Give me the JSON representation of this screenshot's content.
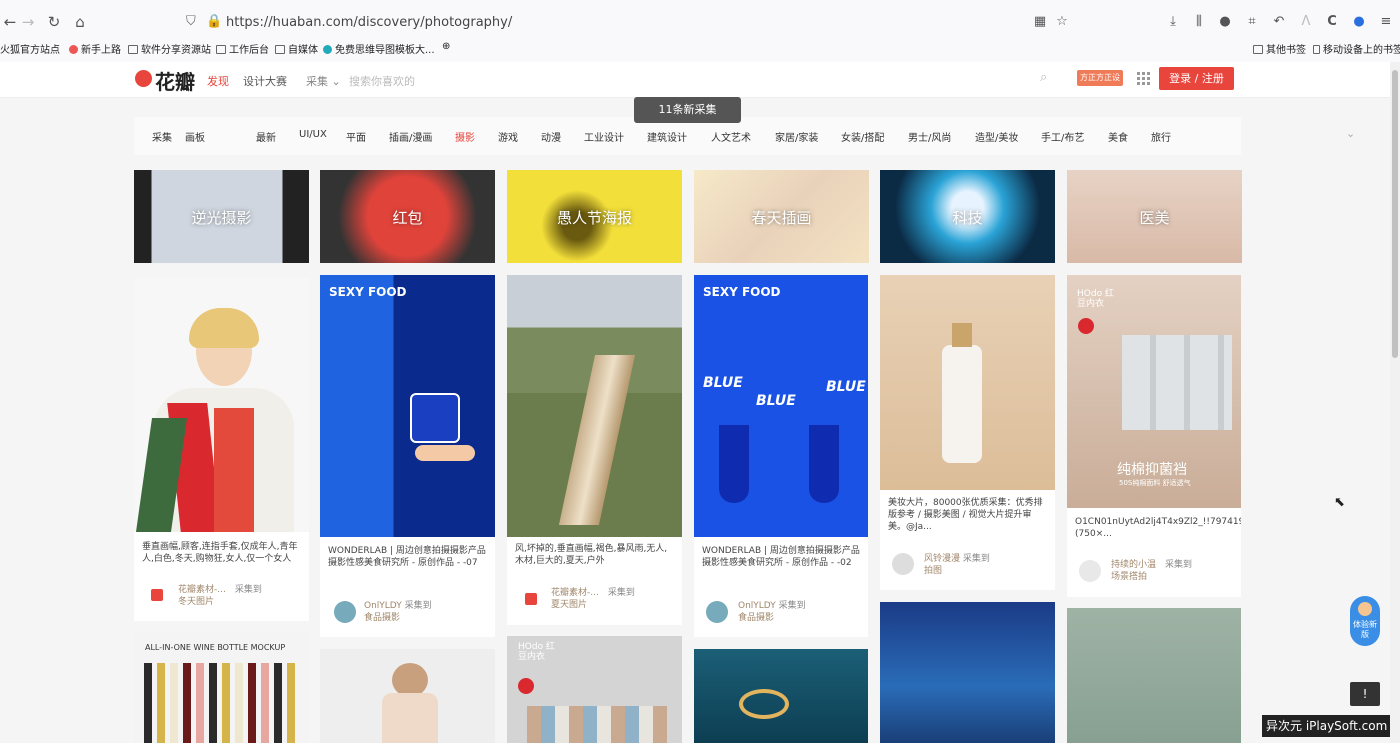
{
  "browser": {
    "url": "https://huaban.com/discovery/photography/",
    "bookmarks": [
      "火狐官方站点",
      "新手上路",
      "软件分享资源站",
      "工作后台",
      "自媒体",
      "免费思维导图模板大...",
      "其他书签",
      "移动设备上的书签"
    ]
  },
  "header": {
    "logo": "花瓣",
    "nav_discover": "发现",
    "nav_contest": "设计大赛",
    "search_scope": "采集",
    "search_placeholder": "搜索你喜欢的",
    "promo": "方正方正设计",
    "login": "登录 / 注册"
  },
  "toast": "11条新采集",
  "categories": {
    "tabs": [
      "采集",
      "画板"
    ],
    "items": [
      "最新",
      "UI/UX",
      "平面",
      "插画/漫画",
      "摄影",
      "游戏",
      "动漫",
      "工业设计",
      "建筑设计",
      "人文艺术",
      "家居/家装",
      "女装/搭配",
      "男士/风尚",
      "造型/美妆",
      "手工/布艺",
      "美食",
      "旅行"
    ],
    "active": "摄影"
  },
  "tiles": [
    "逆光摄影",
    "红包",
    "愚人节海报",
    "春天插画",
    "科技",
    "医美"
  ],
  "cards": {
    "c1": {
      "desc": "垂直画幅,顾客,连指手套,仅成年人,青年人,白色,冬天,购物狂,女人,仅一个女人",
      "user": "花瓣素材-...",
      "action": "采集到",
      "board": "冬天图片"
    },
    "c2": {
      "brand": "SEXY FOOD",
      "desc": "WONDERLAB | 周边创意拍摄摄影产品摄影性感美食研究所 - 原创作品 - -07",
      "user": "OnlYLDY",
      "action": "采集到",
      "board": "食品摄影"
    },
    "c3": {
      "desc": "风,坏掉的,垂直画幅,褐色,暴风雨,无人,木材,巨大的,夏天,户外",
      "user": "花瓣素材-...",
      "action": "采集到",
      "board": "夏天图片"
    },
    "c4": {
      "brand": "SEXY FOOD",
      "blue": "BLUE",
      "desc": "WONDERLAB | 周边创意拍摄摄影产品摄影性感美食研究所 - 原创作品 - -02",
      "user": "OnlYLDY",
      "action": "采集到",
      "board": "食品摄影"
    },
    "c5": {
      "desc": "美妆大片，80000张优质采集：优秀排版参考 / 摄影美图 / 视觉大片提升审美。@Ja...",
      "user": "风铃漫漫",
      "action": "采集到",
      "board": "拍图"
    },
    "c6": {
      "brand": "HOdo 红豆内衣",
      "overlay": "纯棉抑菌裆",
      "overlay_sub": "50S纯棉面料 舒适透气",
      "desc": "O1CN01nUytAd2lj4T4x9Zl2_!!797419321.jpg (750×...",
      "user": "持续的小温",
      "action": "采集到",
      "board": "场景搭拍"
    },
    "c7": {
      "title": "ALL-IN-ONE WINE BOTTLE MOCKUP"
    },
    "c9": {
      "brand": "HOdo 红豆内衣"
    }
  },
  "widgets": {
    "experience": "体验新版",
    "watermark": "异次元 iPlaySoft.com"
  }
}
